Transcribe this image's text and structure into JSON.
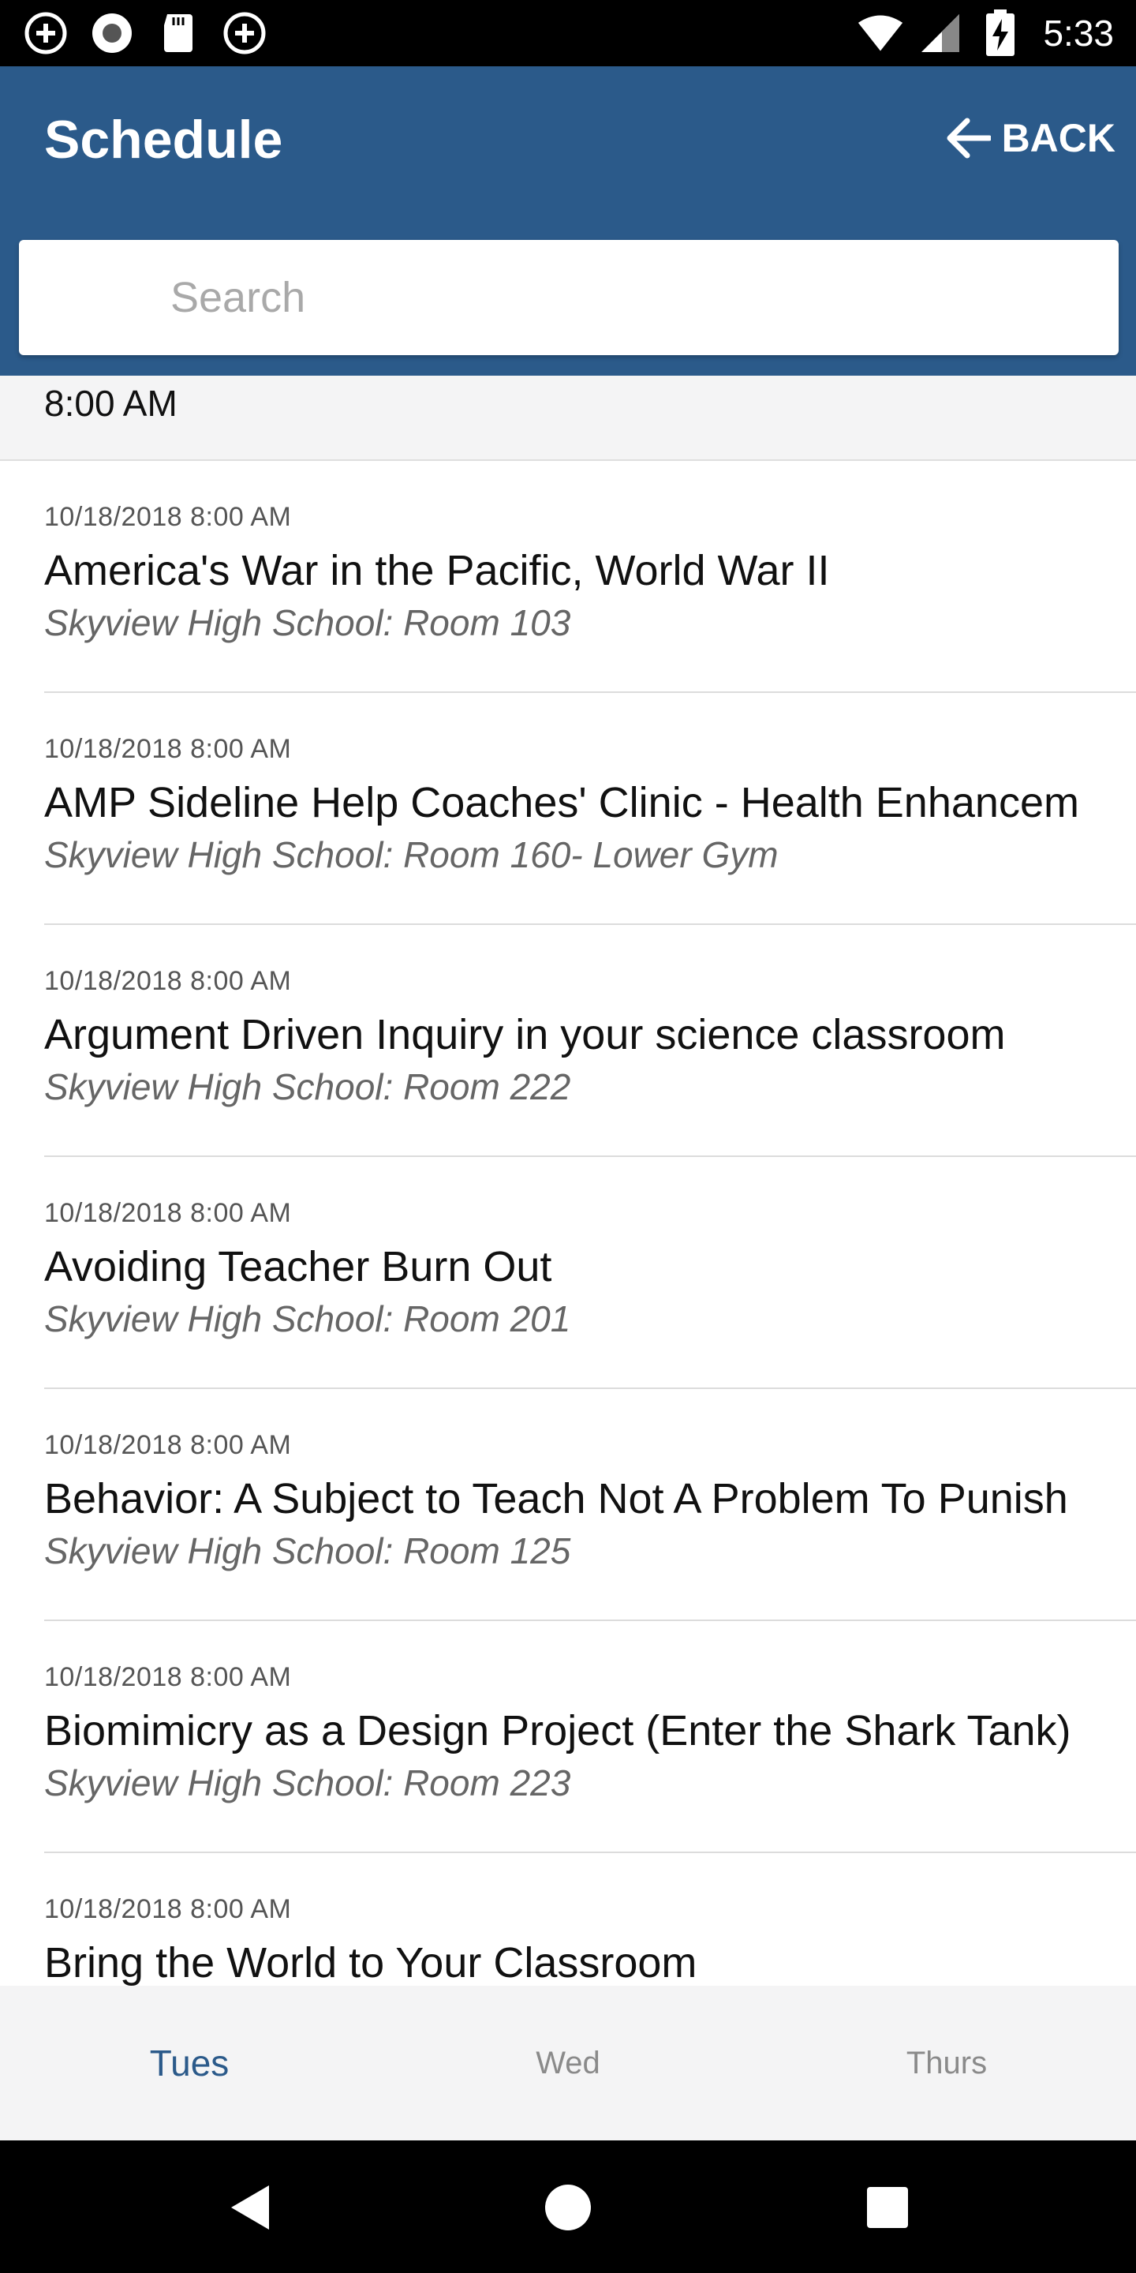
{
  "status_bar": {
    "time": "5:33",
    "left_icons": [
      "add-circle-icon",
      "record-icon",
      "sd-card-icon",
      "add-circle-icon"
    ],
    "right_icons": [
      "wifi-icon",
      "cell-signal-icon",
      "battery-charging-icon"
    ]
  },
  "app_bar": {
    "title": "Schedule",
    "back_label": "BACK",
    "background": "#2b5a8a"
  },
  "search": {
    "placeholder": "Search",
    "value": ""
  },
  "section": {
    "header": "8:00 AM"
  },
  "sessions": [
    {
      "date": "10/18/2018 8:00 AM",
      "title": "America's War in the Pacific, World War II",
      "location": "Skyview High School: Room 103"
    },
    {
      "date": "10/18/2018 8:00 AM",
      "title": "AMP Sideline Help Coaches' Clinic - Health Enhancem",
      "location": "Skyview High School: Room 160- Lower Gym"
    },
    {
      "date": "10/18/2018 8:00 AM",
      "title": "Argument Driven Inquiry in your science classroom",
      "location": "Skyview High School: Room 222"
    },
    {
      "date": "10/18/2018 8:00 AM",
      "title": "Avoiding Teacher Burn Out",
      "location": "Skyview High School: Room 201"
    },
    {
      "date": "10/18/2018 8:00 AM",
      "title": "Behavior: A Subject to Teach Not A Problem To Punish",
      "location": "Skyview High School: Room 125"
    },
    {
      "date": "10/18/2018 8:00 AM",
      "title": "Biomimicry as a Design Project (Enter the Shark Tank)",
      "location": "Skyview High School: Room 223"
    },
    {
      "date": "10/18/2018 8:00 AM",
      "title": "Bring the World to Your Classroom",
      "location": ""
    }
  ],
  "tabs": [
    {
      "label": "Tues",
      "active": true
    },
    {
      "label": "Wed",
      "active": false
    },
    {
      "label": "Thurs",
      "active": false
    }
  ],
  "nav": {
    "icons": [
      "back-triangle-icon",
      "home-circle-icon",
      "recents-square-icon"
    ]
  }
}
